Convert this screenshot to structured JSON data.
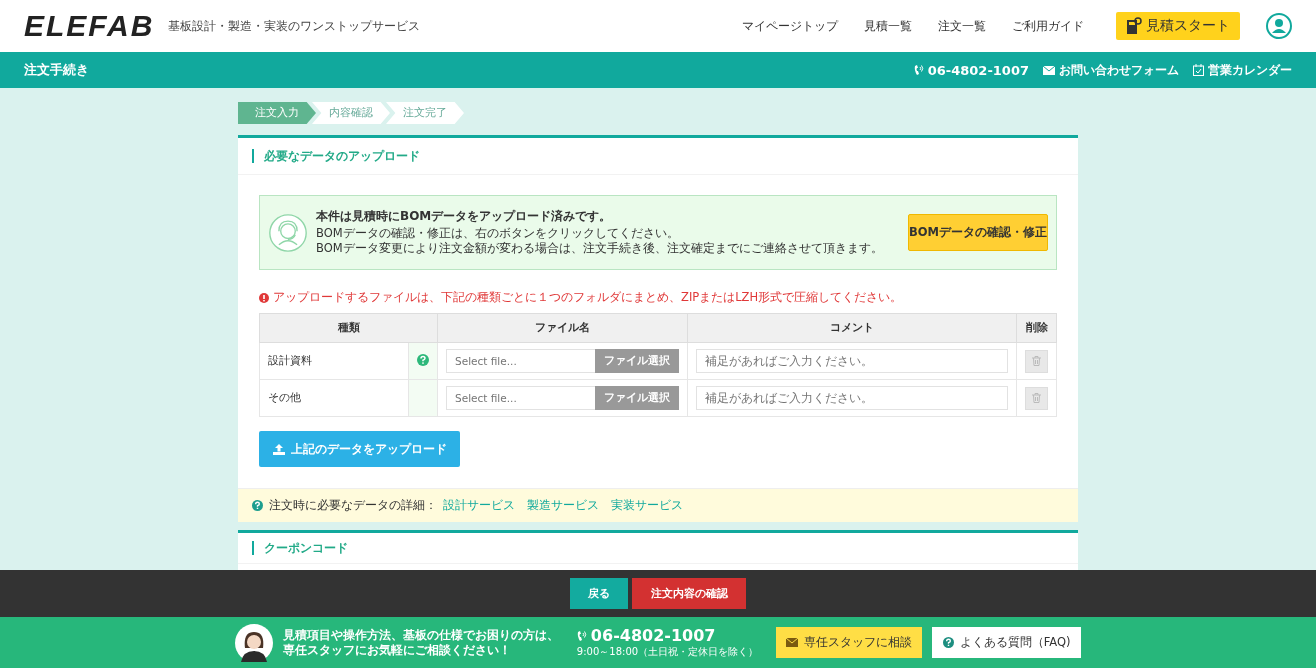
{
  "header": {
    "logo": "ELEFAB",
    "tagline": "基板設計・製造・実装のワンストップサービス",
    "nav": [
      "マイページトップ",
      "見積一覧",
      "注文一覧",
      "ご利用ガイド"
    ],
    "cta": "見積スタート"
  },
  "subbar": {
    "title": "注文手続き",
    "phone": "06-4802-1007",
    "contact": "お問い合わせフォーム",
    "calendar": "営業カレンダー"
  },
  "steps": [
    {
      "label": "注文入力",
      "selected": true
    },
    {
      "label": "内容確認",
      "selected": false
    },
    {
      "label": "注文完了",
      "selected": false
    }
  ],
  "upload_card": {
    "title": "必要なデータのアップロード",
    "notice": {
      "heading": "本件は見積時にBOMデータをアップロード済みです。",
      "lines": [
        "BOMデータの確認・修正は、右のボタンをクリックしてください。",
        "BOMデータ変更により注文金額が変わる場合は、注文手続き後、注文確定までにご連絡させて頂きます。"
      ],
      "button": "BOMデータの確認・修正"
    },
    "warning": "アップロードするファイルは、下記の種類ごとに１つのフォルダにまとめ、ZIPまたはLZH形式で圧縮してください。",
    "table": {
      "columns": [
        "種類",
        "ファイル名",
        "コメント",
        "削除"
      ],
      "rows": [
        {
          "type": "設計資料",
          "help": true,
          "file_placeholder": "Select file...",
          "file_button": "ファイル選択",
          "comment_placeholder": "補足があればご入力ください。"
        },
        {
          "type": "その他",
          "help": false,
          "file_placeholder": "Select file...",
          "file_button": "ファイル選択",
          "comment_placeholder": "補足があればご入力ください。"
        }
      ]
    },
    "upload_button": "上記のデータをアップロード",
    "footer": {
      "label": "注文時に必要なデータの詳細：",
      "links": [
        "設計サービス",
        "製造サービス",
        "実装サービス"
      ]
    }
  },
  "coupon_card": {
    "title": "クーポンコード"
  },
  "action_bar": {
    "back": "戻る",
    "confirm": "注文内容の確認"
  },
  "support_bar": {
    "lines": [
      "見積項目や操作方法、基板の仕様でお困りの方は、",
      "専任スタッフにお気軽にご相談ください！"
    ],
    "phone": "06-4802-1007",
    "hours": "9:00～18:00（土日祝・定休日を除く）",
    "staff_button": "専任スタッフに相談",
    "faq_button": "よくある質問（FAQ)"
  }
}
